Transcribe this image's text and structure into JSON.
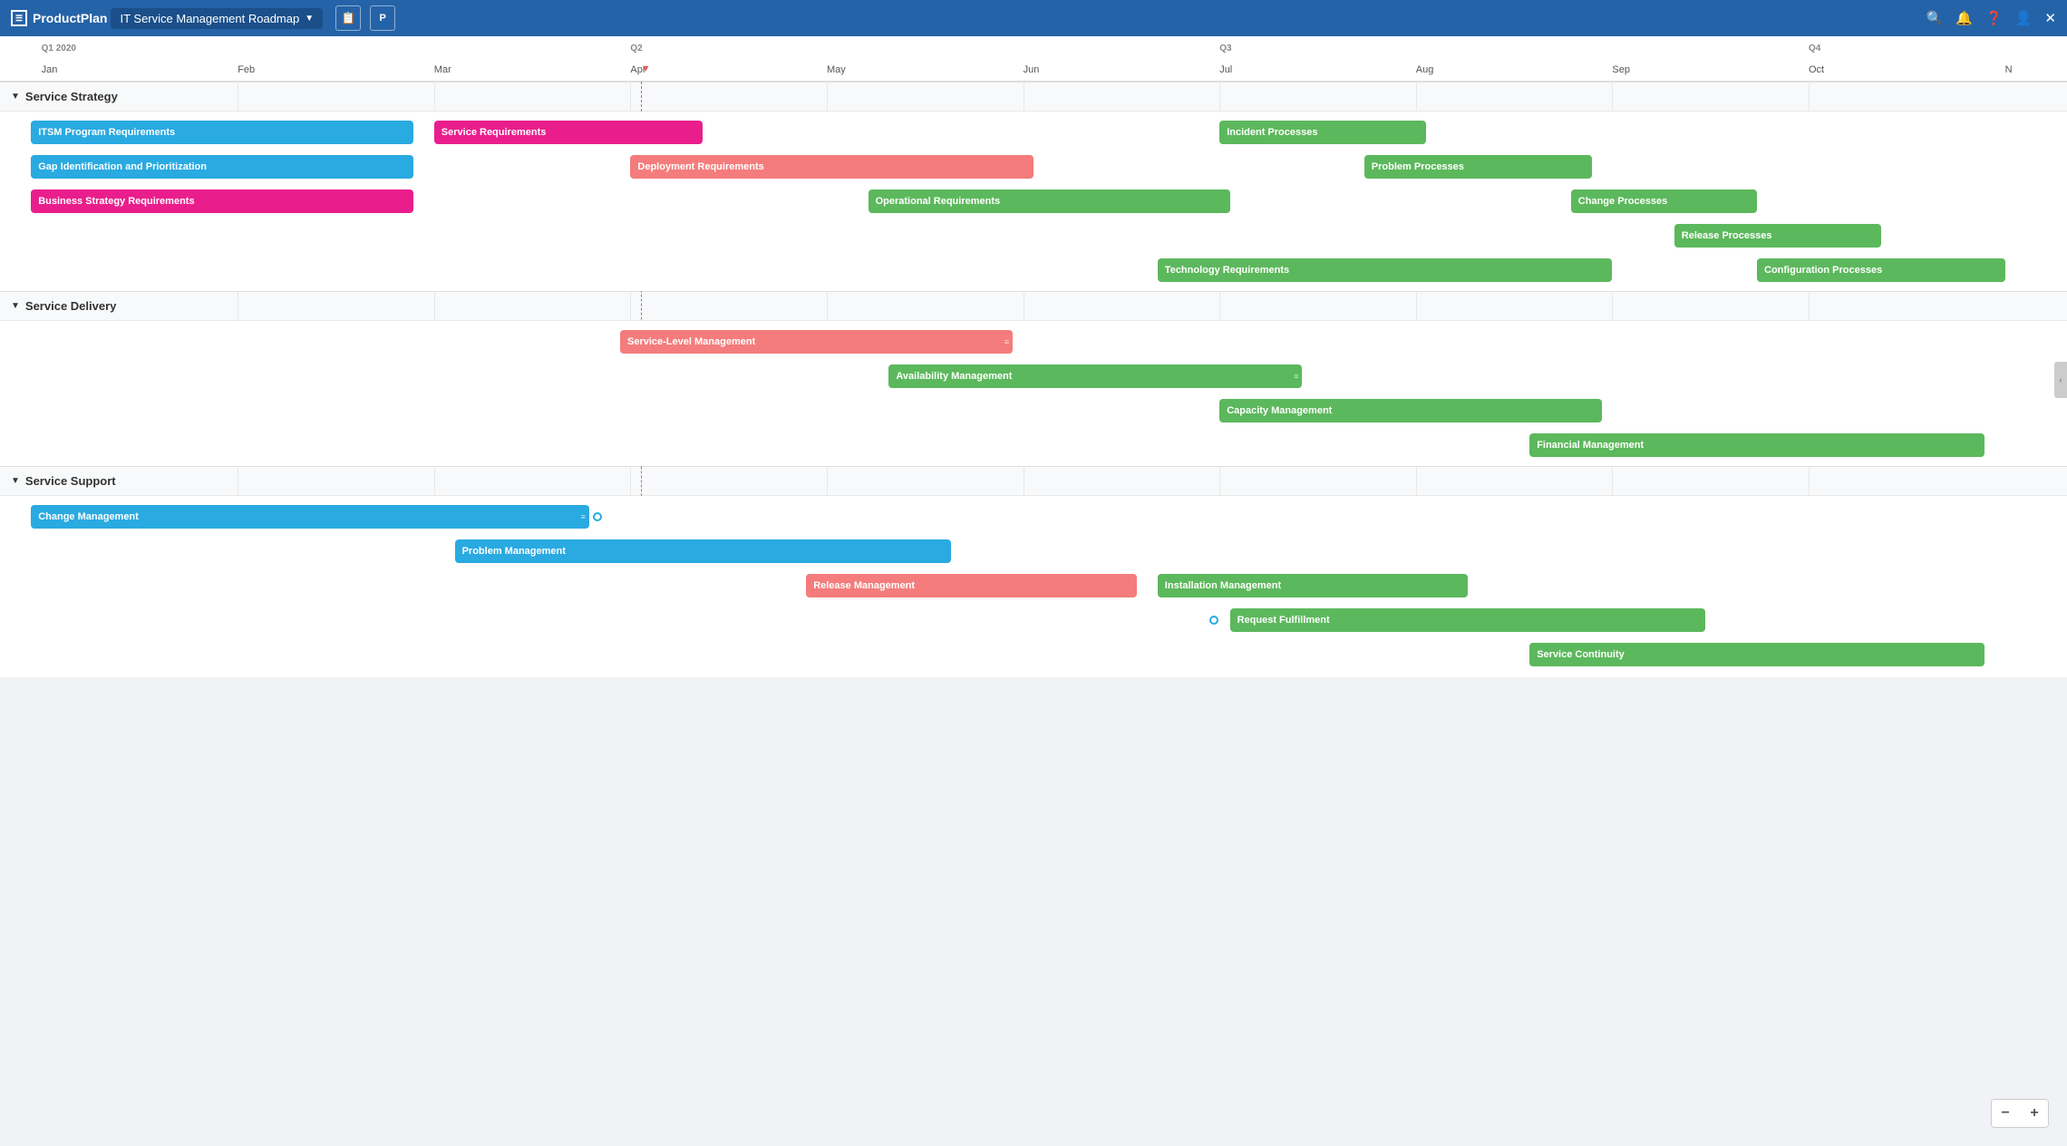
{
  "app": {
    "brand": "ProductPlan",
    "title": "IT Service Management Roadmap",
    "nav_icons": [
      "search",
      "bell",
      "question",
      "user",
      "close"
    ]
  },
  "toolbar": {
    "copy_label": "📋",
    "bookmark_label": "🅿"
  },
  "timeline": {
    "quarters": [
      {
        "label": "Q1 2020",
        "offset_pct": 2
      },
      {
        "label": "Q2",
        "offset_pct": 30
      },
      {
        "label": "Q3",
        "offset_pct": 59
      },
      {
        "label": "Q4",
        "offset_pct": 88
      }
    ],
    "months": [
      {
        "label": "Jan",
        "offset_pct": 2
      },
      {
        "label": "Feb",
        "offset_pct": 11.5
      },
      {
        "label": "Mar",
        "offset_pct": 21
      },
      {
        "label": "Apr",
        "offset_pct": 30.5
      },
      {
        "label": "May",
        "offset_pct": 40
      },
      {
        "label": "Jun",
        "offset_pct": 49.5
      },
      {
        "label": "Jul",
        "offset_pct": 59
      },
      {
        "label": "Aug",
        "offset_pct": 68.5
      },
      {
        "label": "Sep",
        "offset_pct": 78
      },
      {
        "label": "Oct",
        "offset_pct": 87.5
      },
      {
        "label": "N",
        "offset_pct": 97
      }
    ],
    "today_offset_pct": 31
  },
  "sections": [
    {
      "id": "service-strategy",
      "label": "Service Strategy",
      "collapsed": false,
      "bars": [
        {
          "id": "itsm-program",
          "label": "ITSM Program Requirements",
          "color": "blue",
          "left_pct": 1.5,
          "width_pct": 18.5
        },
        {
          "id": "service-req",
          "label": "Service Requirements",
          "color": "pink",
          "left_pct": 21,
          "width_pct": 13
        },
        {
          "id": "incident-proc",
          "label": "Incident Processes",
          "color": "green",
          "left_pct": 59,
          "width_pct": 10
        },
        {
          "id": "gap-id",
          "label": "Gap Identification and Prioritization",
          "color": "blue",
          "left_pct": 1.5,
          "width_pct": 18.5,
          "row": 2
        },
        {
          "id": "deploy-req",
          "label": "Deployment Requirements",
          "color": "salmon",
          "left_pct": 30.5,
          "width_pct": 19.5,
          "row": 2
        },
        {
          "id": "problem-proc",
          "label": "Problem Processes",
          "color": "green",
          "left_pct": 66,
          "width_pct": 11,
          "row": 2
        },
        {
          "id": "biz-strat",
          "label": "Business Strategy Requirements",
          "color": "pink",
          "left_pct": 1.5,
          "width_pct": 18.5,
          "row": 3
        },
        {
          "id": "op-req",
          "label": "Operational Requirements",
          "color": "green",
          "left_pct": 42,
          "width_pct": 17.5,
          "row": 3
        },
        {
          "id": "change-proc",
          "label": "Change Processes",
          "color": "green",
          "left_pct": 76,
          "width_pct": 9,
          "row": 3
        },
        {
          "id": "release-proc",
          "label": "Release Processes",
          "color": "green",
          "left_pct": 81,
          "width_pct": 10,
          "row": 4
        },
        {
          "id": "tech-req",
          "label": "Technology Requirements",
          "color": "green",
          "left_pct": 56,
          "width_pct": 22,
          "row": 5
        },
        {
          "id": "config-proc",
          "label": "Configuration Processes",
          "color": "green",
          "left_pct": 85,
          "width_pct": 12,
          "row": 5
        }
      ]
    },
    {
      "id": "service-delivery",
      "label": "Service Delivery",
      "collapsed": false,
      "bars": [
        {
          "id": "slm",
          "label": "Service-Level Management",
          "color": "salmon",
          "left_pct": 30,
          "width_pct": 19,
          "row": 1,
          "has_handle": true
        },
        {
          "id": "avail-mgmt",
          "label": "Availability Management",
          "color": "green",
          "left_pct": 43,
          "width_pct": 20,
          "row": 2,
          "has_handle": true
        },
        {
          "id": "cap-mgmt",
          "label": "Capacity Management",
          "color": "green",
          "left_pct": 59,
          "width_pct": 18.5,
          "row": 3
        },
        {
          "id": "fin-mgmt",
          "label": "Financial Management",
          "color": "green",
          "left_pct": 74,
          "width_pct": 22,
          "row": 4
        }
      ]
    },
    {
      "id": "service-support",
      "label": "Service Support",
      "collapsed": false,
      "bars": [
        {
          "id": "change-mgmt",
          "label": "Change Management",
          "color": "blue",
          "left_pct": 1.5,
          "width_pct": 27,
          "row": 1,
          "has_handle": true,
          "has_milestone": true,
          "milestone_offset": 28.7
        },
        {
          "id": "prob-mgmt",
          "label": "Problem Management",
          "color": "blue",
          "left_pct": 22,
          "width_pct": 24,
          "row": 2
        },
        {
          "id": "rel-mgmt",
          "label": "Release Management",
          "color": "salmon",
          "left_pct": 39,
          "width_pct": 16,
          "row": 3
        },
        {
          "id": "install-mgmt",
          "label": "Installation Management",
          "color": "green",
          "left_pct": 56,
          "width_pct": 15,
          "row": 3
        },
        {
          "id": "req-fulfill",
          "label": "Request Fulfillment",
          "color": "green",
          "left_pct": 59,
          "width_pct": 23,
          "row": 4,
          "has_milestone": true,
          "milestone_offset": 58.8
        },
        {
          "id": "svc-cont",
          "label": "Service Continuity",
          "color": "green",
          "left_pct": 74,
          "width_pct": 22,
          "row": 5
        }
      ]
    }
  ],
  "zoom": {
    "minus": "−",
    "plus": "+"
  }
}
